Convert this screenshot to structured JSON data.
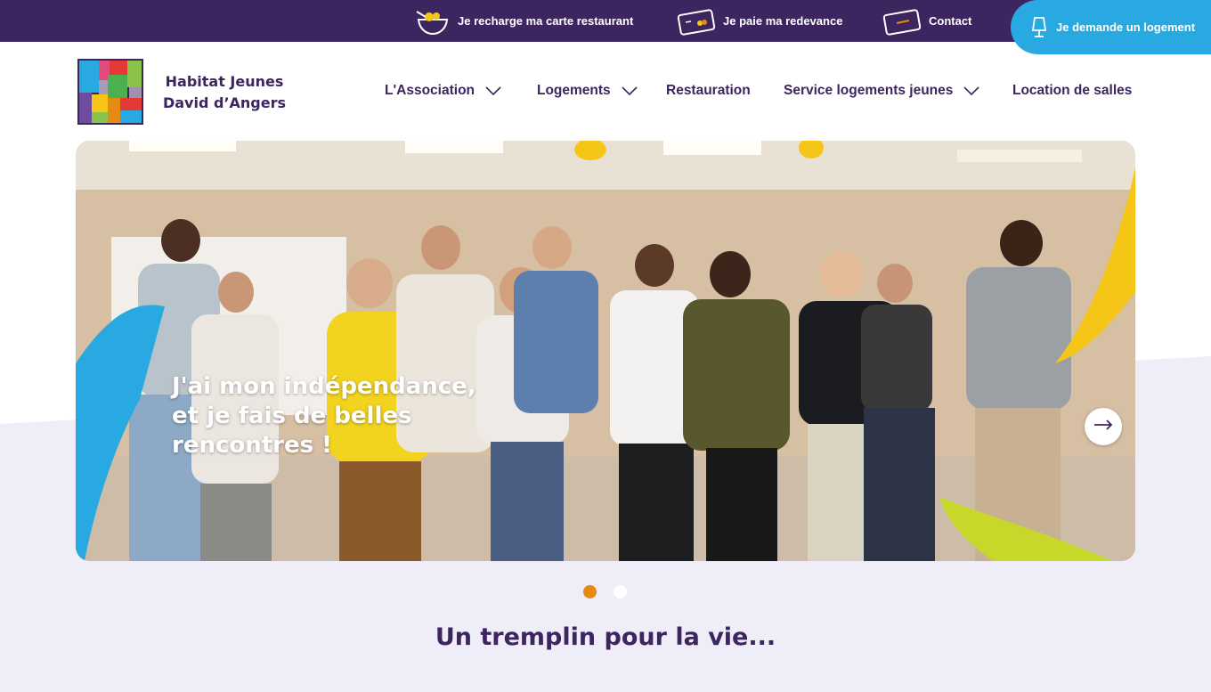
{
  "topbar": {
    "links": [
      {
        "label": "Je recharge ma carte restaurant",
        "icon": "bowl-icon"
      },
      {
        "label": "Je paie ma redevance",
        "icon": "card-icon"
      },
      {
        "label": "Contact",
        "icon": "envelope-icon"
      }
    ],
    "cta": {
      "label": "Je demande un logement",
      "icon": "lamp-icon"
    }
  },
  "brand": {
    "line1": "Habitat Jeunes",
    "line2": "David d’Angers"
  },
  "nav": [
    {
      "label": "L'Association",
      "has_dropdown": true
    },
    {
      "label": "Logements",
      "has_dropdown": true
    },
    {
      "label": "Restauration",
      "has_dropdown": false
    },
    {
      "label": "Service logements jeunes",
      "has_dropdown": true
    },
    {
      "label": "Location de salles",
      "has_dropdown": false
    }
  ],
  "hero": {
    "caption_line1": "J'ai mon indépendance,",
    "caption_line2": "et je fais de belles",
    "caption_line3": "rencontres !",
    "slide_count": 2,
    "active_slide": 1
  },
  "tagline": "Un tremplin pour la vie...",
  "colors": {
    "primary": "#3d2560",
    "accent_blue": "#29a9e1",
    "accent_orange": "#e58a12",
    "light_bg": "#efedf8"
  }
}
